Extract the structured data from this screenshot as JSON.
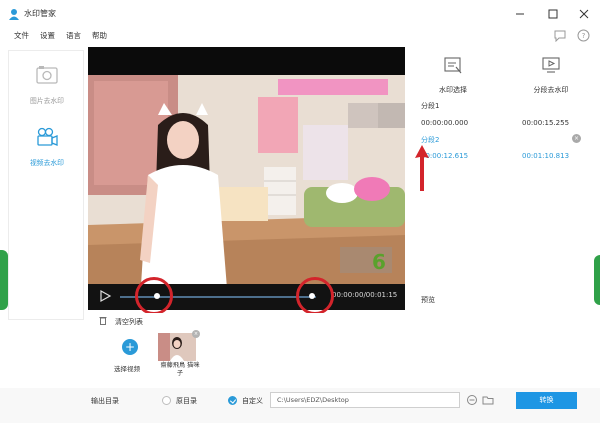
{
  "window": {
    "title": "水印管家",
    "minimize_icon": "minimize-icon",
    "maximize_icon": "maximize-icon",
    "close_icon": "close-icon"
  },
  "menu": {
    "items": [
      "文件",
      "设置",
      "语言",
      "帮助"
    ]
  },
  "sidebar": {
    "items": [
      {
        "label": "图片去水印",
        "icon": "image-icon",
        "active": false
      },
      {
        "label": "视频去水印",
        "icon": "video-camera-icon",
        "active": true
      }
    ]
  },
  "player": {
    "time": "00:00:00/00:01:15",
    "progress_start": 0.19,
    "progress_end": 0.98
  },
  "tools": {
    "select_label": "水印选择",
    "segment_label": "分段去水印"
  },
  "segments": [
    {
      "label": "分段1",
      "start": "00:00:00.000",
      "end": "00:00:15.255",
      "active": false
    },
    {
      "label": "分段2",
      "start": "00:00:12.615",
      "end": "00:01:10.813",
      "active": true
    }
  ],
  "preview": {
    "label": "预览"
  },
  "file_list": {
    "clear_label": "清空列表",
    "add_label": "选择视频",
    "items": [
      {
        "name": "齋藤飛鳥 猫咪子"
      }
    ]
  },
  "output": {
    "label": "输出目录",
    "option_original": "原目录",
    "option_custom": "自定义",
    "path": "C:\\Users\\EDZ\\Desktop",
    "convert_label": "转换"
  },
  "video_overlay": {
    "badge": "6"
  },
  "colors": {
    "accent": "#2a9ad8",
    "annotation_red": "#d3242b",
    "convert_button": "#1e96e4"
  }
}
